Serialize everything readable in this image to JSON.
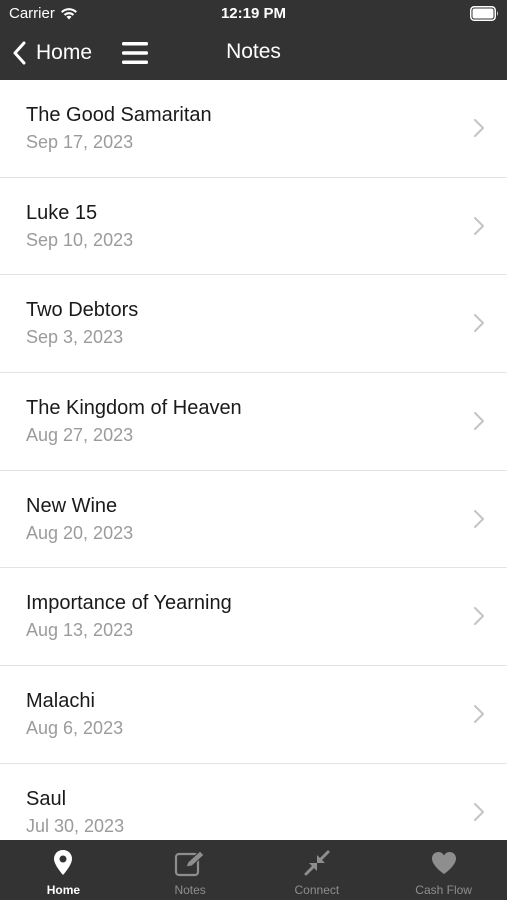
{
  "status_bar": {
    "carrier": "Carrier",
    "time": "12:19 PM"
  },
  "nav": {
    "back_label": "Home",
    "title": "Notes"
  },
  "notes": [
    {
      "title": "The Good Samaritan",
      "date": "Sep 17, 2023"
    },
    {
      "title": "Luke 15",
      "date": "Sep 10, 2023"
    },
    {
      "title": "Two Debtors",
      "date": "Sep 3, 2023"
    },
    {
      "title": "The Kingdom of Heaven",
      "date": "Aug 27, 2023"
    },
    {
      "title": "New Wine",
      "date": "Aug 20, 2023"
    },
    {
      "title": "Importance of Yearning",
      "date": "Aug 13, 2023"
    },
    {
      "title": "Malachi",
      "date": "Aug 6, 2023"
    },
    {
      "title": "Saul",
      "date": "Jul 30, 2023"
    }
  ],
  "tabs": [
    {
      "label": "Home",
      "icon": "map-pin-icon",
      "active": true
    },
    {
      "label": "Notes",
      "icon": "edit-note-icon",
      "active": false
    },
    {
      "label": "Connect",
      "icon": "connect-arrows-icon",
      "active": false
    },
    {
      "label": "Cash Flow",
      "icon": "heart-icon",
      "active": false
    }
  ],
  "colors": {
    "bar_background": "#333333",
    "inactive_tab": "#8e8e8e",
    "date_text": "#9b9b9b"
  }
}
